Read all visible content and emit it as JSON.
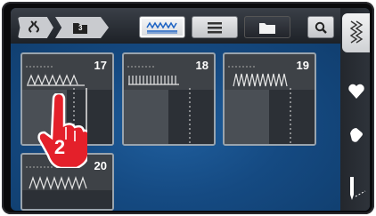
{
  "toolbar": {
    "breadcrumb": [
      {
        "icon": "stitch-category-icon"
      },
      {
        "icon": "folder-3-icon",
        "label": "3"
      }
    ],
    "buttons": [
      {
        "icon": "stitch-pattern-icon",
        "state": "active"
      },
      {
        "icon": "list-icon"
      },
      {
        "icon": "folder-icon",
        "state": "selected"
      },
      {
        "icon": "search-icon"
      }
    ]
  },
  "side_tabs": [
    {
      "icon": "stitch-icon",
      "state": "active"
    },
    {
      "icon": "heart-icon"
    },
    {
      "icon": "hand-icon"
    },
    {
      "icon": "needle-icon"
    }
  ],
  "stitches": [
    {
      "number": "17"
    },
    {
      "number": "18"
    },
    {
      "number": "19"
    },
    {
      "number": "20"
    }
  ],
  "pointer": {
    "step": "2"
  },
  "colors": {
    "accent": "#1a5a97",
    "card_border": "#9aa4ad",
    "pointer": "#e4202a"
  }
}
